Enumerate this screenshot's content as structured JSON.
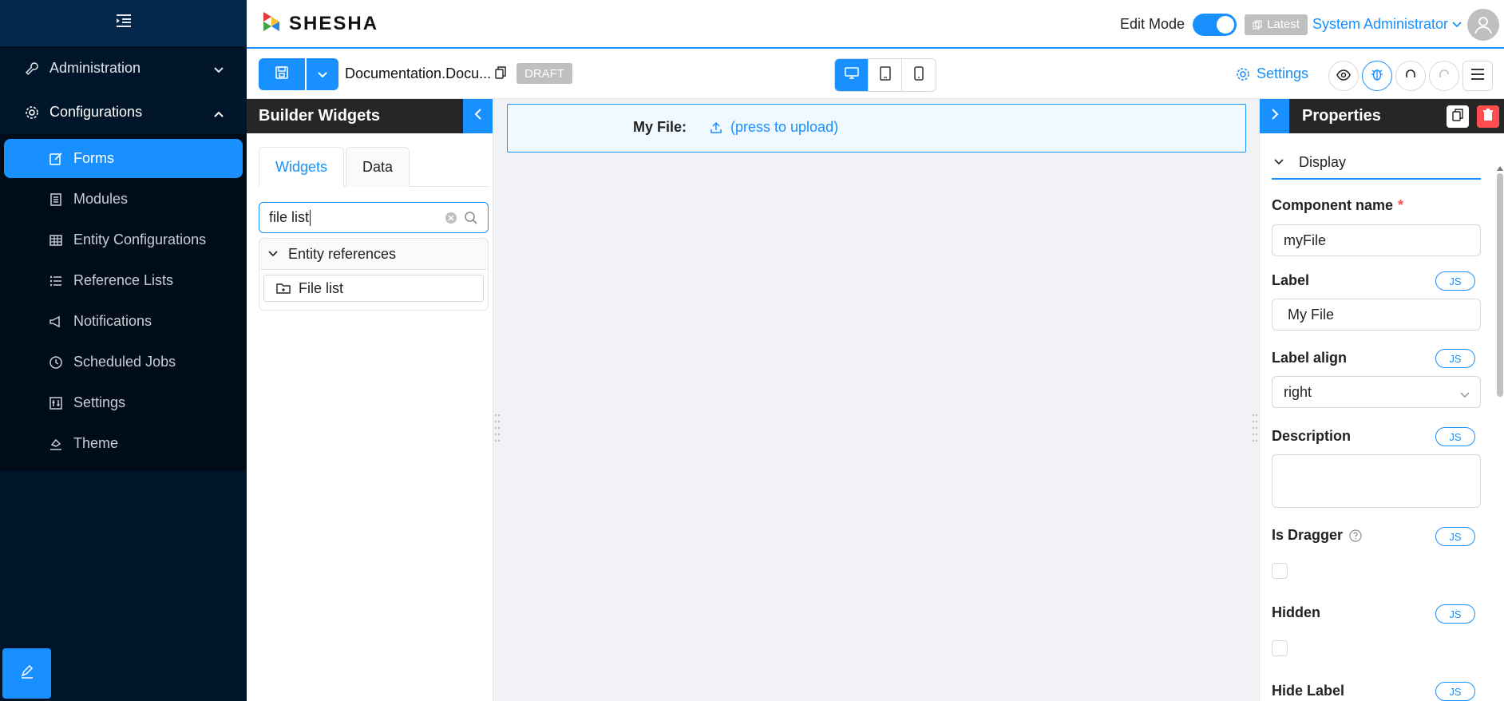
{
  "sidebar": {
    "groups": [
      {
        "label": "Administration",
        "icon": "wrench-icon",
        "expanded": false
      },
      {
        "label": "Configurations",
        "icon": "gear-icon",
        "expanded": true
      }
    ],
    "items": [
      {
        "label": "Forms",
        "icon": "edit-icon",
        "active": true
      },
      {
        "label": "Modules",
        "icon": "module-icon"
      },
      {
        "label": "Entity Configurations",
        "icon": "table-icon"
      },
      {
        "label": "Reference Lists",
        "icon": "list-icon"
      },
      {
        "label": "Notifications",
        "icon": "megaphone-icon"
      },
      {
        "label": "Scheduled Jobs",
        "icon": "clock-icon"
      },
      {
        "label": "Settings",
        "icon": "sliders-icon"
      },
      {
        "label": "Theme",
        "icon": "paint-icon"
      }
    ]
  },
  "header": {
    "logo_text": "SHESHA",
    "edit_mode_label": "Edit Mode",
    "latest_label": "Latest",
    "user_name": "System Administrator"
  },
  "toolbar": {
    "form_name": "Documentation.Docu...",
    "status_badge": "DRAFT",
    "settings_label": "Settings"
  },
  "widgets_panel": {
    "title": "Builder Widgets",
    "tabs": [
      "Widgets",
      "Data"
    ],
    "search_value": "file list",
    "group_label": "Entity references",
    "widget_label": "File list"
  },
  "canvas": {
    "field_label": "My File:",
    "upload_text": "(press to upload)"
  },
  "properties": {
    "title": "Properties",
    "section": "Display",
    "component_name_label": "Component name",
    "component_name_value": "myFile",
    "label_label": "Label",
    "label_value": "My File",
    "label_align_label": "Label align",
    "label_align_value": "right",
    "description_label": "Description",
    "is_dragger_label": "Is Dragger",
    "hidden_label": "Hidden",
    "hide_label_label": "Hide Label",
    "js_label": "JS"
  },
  "colors": {
    "accent": "#1890ff",
    "sidebar_bg": "#001529",
    "danger": "#ff4d4f"
  }
}
